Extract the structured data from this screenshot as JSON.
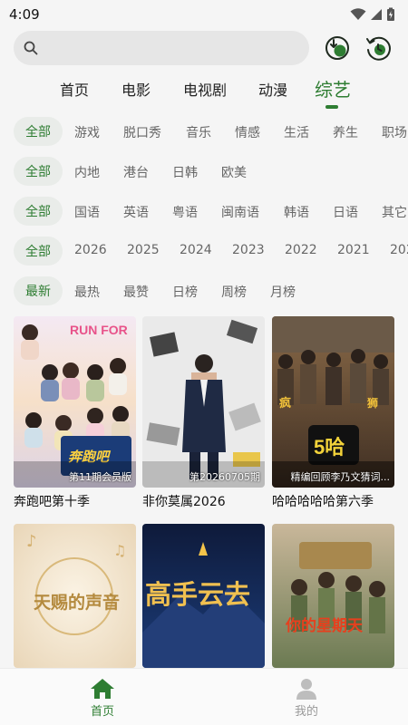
{
  "status": {
    "time": "4:09"
  },
  "search": {
    "placeholder": ""
  },
  "top_actions": [
    "download-icon",
    "history-icon"
  ],
  "tabs": [
    {
      "label": "首页",
      "active": false
    },
    {
      "label": "电影",
      "active": false
    },
    {
      "label": "电视剧",
      "active": false
    },
    {
      "label": "动漫",
      "active": false
    },
    {
      "label": "综艺",
      "active": true
    }
  ],
  "filters": {
    "genre": {
      "selected": "全部",
      "items": [
        "游戏",
        "脱口秀",
        "音乐",
        "情感",
        "生活",
        "养生",
        "职场"
      ]
    },
    "region": {
      "selected": "全部",
      "items": [
        "内地",
        "港台",
        "日韩",
        "欧美"
      ]
    },
    "language": {
      "selected": "全部",
      "items": [
        "国语",
        "英语",
        "粤语",
        "闽南语",
        "韩语",
        "日语",
        "其它"
      ]
    },
    "year": {
      "selected": "全部",
      "items": [
        "2026",
        "2025",
        "2024",
        "2023",
        "2022",
        "2021",
        "202"
      ]
    },
    "sort": {
      "selected": "最新",
      "items": [
        "最热",
        "最赞",
        "日榜",
        "周榜",
        "月榜"
      ]
    }
  },
  "cards": [
    {
      "title": "奔跑吧第十季",
      "badge": "第11期会员版",
      "poster_text": "RUN FOR"
    },
    {
      "title": "非你莫属2026",
      "badge": "第20260705期",
      "poster_text": ""
    },
    {
      "title": "哈哈哈哈哈第六季",
      "badge": "精编回顾李乃文猜词...",
      "poster_text": "5哈"
    },
    {
      "title": "",
      "badge": "",
      "poster_text": "天赐的声音"
    },
    {
      "title": "",
      "badge": "",
      "poster_text": "高手云去"
    },
    {
      "title": "",
      "badge": "",
      "poster_text": "你的星期天"
    }
  ],
  "bottom_nav": [
    {
      "label": "首页",
      "active": true
    },
    {
      "label": "我的",
      "active": false
    }
  ],
  "colors": {
    "accent": "#2e7d32",
    "background": "#f5f5f5"
  }
}
